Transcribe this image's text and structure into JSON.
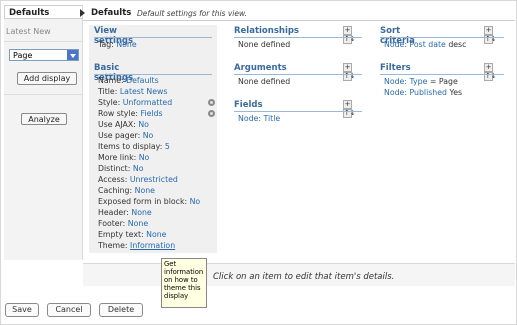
{
  "left": {
    "tab_defaults": "Defaults",
    "tab_latest": "Latest New",
    "display_select": "Page",
    "add_display_label": "Add display",
    "analyze_label": "Analyze"
  },
  "header": {
    "title": "Defaults",
    "description": "Default settings for this view."
  },
  "view_settings": {
    "title": "View settings",
    "tag_label": "Tag:",
    "tag_value": "None"
  },
  "basic_settings": {
    "title": "Basic settings",
    "rows": [
      {
        "label": "Name:",
        "value": "Defaults"
      },
      {
        "label": "Title:",
        "value": "Latest News"
      },
      {
        "label": "Style:",
        "value": "Unformatted"
      },
      {
        "label": "Row style:",
        "value": "Fields"
      },
      {
        "label": "Use AJAX:",
        "value": "No"
      },
      {
        "label": "Use pager:",
        "value": "No"
      },
      {
        "label": "Items to display:",
        "value": "5"
      },
      {
        "label": "More link:",
        "value": "No"
      },
      {
        "label": "Distinct:",
        "value": "No"
      },
      {
        "label": "Access:",
        "value": "Unrestricted"
      },
      {
        "label": "Caching:",
        "value": "None"
      },
      {
        "label": "Exposed form in block:",
        "value": "No"
      },
      {
        "label": "Header:",
        "value": "None"
      },
      {
        "label": "Footer:",
        "value": "None"
      },
      {
        "label": "Empty text:",
        "value": "None"
      },
      {
        "label": "Theme:",
        "value": "Information"
      }
    ]
  },
  "relationships": {
    "title": "Relationships",
    "value": "None defined"
  },
  "arguments": {
    "title": "Arguments",
    "value": "None defined"
  },
  "fields": {
    "title": "Fields",
    "value": "Node: Title"
  },
  "sort_criteria": {
    "title": "Sort criteria",
    "value": "Node: Post date",
    "order": "desc"
  },
  "filters": {
    "title": "Filters",
    "items": [
      {
        "label": "Node: Type",
        "op": "= Page"
      },
      {
        "label": "Node: Published",
        "op": "Yes"
      }
    ]
  },
  "footer": {
    "message": "Click on an item to edit that item's details."
  },
  "tooltip": {
    "text": "Get information on how to theme this display"
  },
  "buttons": {
    "save": "Save",
    "cancel": "Cancel",
    "delete": "Delete"
  },
  "icons": {
    "add": "+",
    "rearrange": "↑↓"
  }
}
